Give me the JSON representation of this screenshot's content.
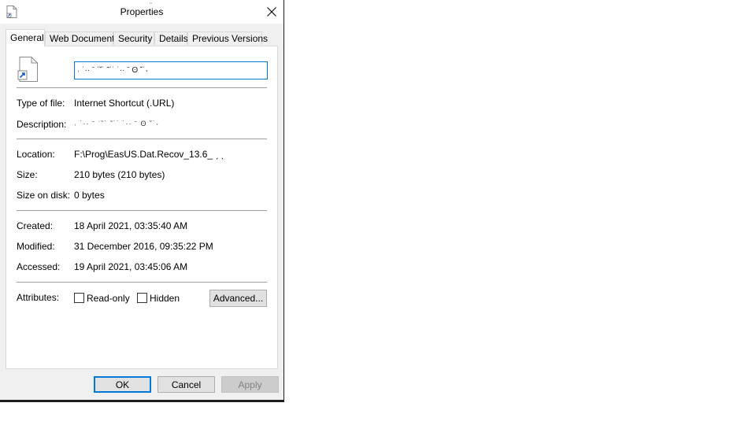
{
  "window": {
    "title": "Properties",
    "title_prefix": "¨"
  },
  "tabs": [
    {
      "label": "General",
      "active": true
    },
    {
      "label": "Web Document",
      "active": false
    },
    {
      "label": "Security",
      "active": false
    },
    {
      "label": "Details",
      "active": false
    },
    {
      "label": "Previous Versions",
      "active": false
    }
  ],
  "general": {
    "name_value": "˓ ˙·· ˉ  ˈ˘˙    ˜˙˙   ˙··  ˉ   ʘ ˘˙˕",
    "type_label": "Type of file:",
    "type_value": "Internet Shortcut (.URL)",
    "description_label": "Description:",
    "description_value": "˓ ˙·· ˉ  ˈ˘˙    ˜˙˙   ˙··  ˉ   ʘ ˘˙˕",
    "location_label": "Location:",
    "location_value": "F:\\Prog\\EasUS.Dat.Recov_13.6_  ˏ     ˎ",
    "size_label": "Size:",
    "size_value": "210 bytes (210 bytes)",
    "size_on_disk_label": "Size on disk:",
    "size_on_disk_value": "0 bytes",
    "created_label": "Created:",
    "created_value": "18 April 2021, 03:35:40 AM",
    "modified_label": "Modified:",
    "modified_value": "31 December 2016, 09:35:22 PM",
    "accessed_label": "Accessed:",
    "accessed_value": "19 April 2021, 03:45:06 AM",
    "attributes_label": "Attributes:",
    "readonly_label": "Read-only",
    "readonly_checked": false,
    "hidden_label": "Hidden",
    "hidden_checked": false,
    "advanced_label": "Advanced..."
  },
  "buttons": {
    "ok": "OK",
    "cancel": "Cancel",
    "apply": "Apply"
  },
  "colors": {
    "accent": "#0078d7",
    "dialog_bg": "#f0f0f0",
    "panel_bg": "#ffffff"
  }
}
